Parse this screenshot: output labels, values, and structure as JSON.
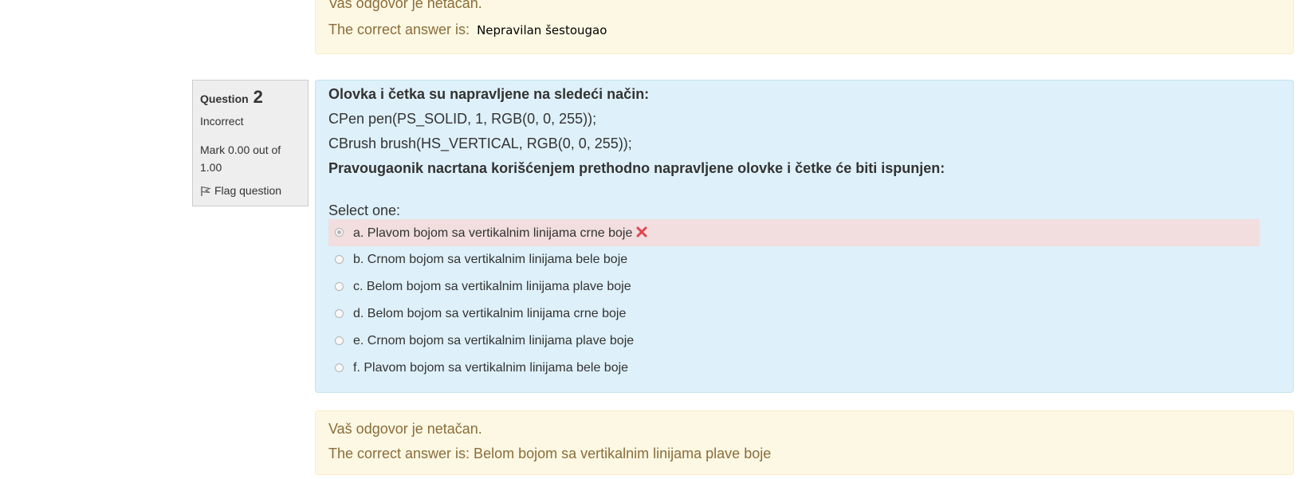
{
  "prev_feedback": {
    "message": "Vaš odgovor je netačan.",
    "correct_prefix": "The correct answer is:",
    "correct_answer": "Nepravilan šestougao"
  },
  "question_info": {
    "label": "Question",
    "number": "2",
    "state": "Incorrect",
    "grade": "Mark 0.00 out of 1.00",
    "flag_label": "Flag question"
  },
  "question": {
    "lines": [
      "Olovka i četka su napravljene na sledeći način:",
      "CPen pen(PS_SOLID, 1, RGB(0, 0, 255));",
      "CBrush brush(HS_VERTICAL, RGB(0, 0, 255));",
      "Pravougaonik nacrtana korišćenjem prethodno napravljene olovke i četke će biti ispunjen:"
    ],
    "prompt": "Select one:",
    "options": [
      {
        "letter": "a.",
        "text": "Plavom bojom sa vertikalnim linijama crne boje",
        "selected": true,
        "status": "incorrect"
      },
      {
        "letter": "b.",
        "text": "Crnom bojom sa vertikalnim linijama bele boje",
        "selected": false,
        "status": ""
      },
      {
        "letter": "c.",
        "text": "Belom bojom sa vertikalnim linijama plave boje",
        "selected": false,
        "status": ""
      },
      {
        "letter": "d.",
        "text": "Belom bojom sa vertikalnim linijama crne boje",
        "selected": false,
        "status": ""
      },
      {
        "letter": "e.",
        "text": "Crnom bojom sa vertikalnim linijama plave boje",
        "selected": false,
        "status": ""
      },
      {
        "letter": "f.",
        "text": "Plavom bojom sa vertikalnim linijama bele boje",
        "selected": false,
        "status": ""
      }
    ],
    "incorrect_icon": "red-x-icon"
  },
  "feedback": {
    "message": "Vaš odgovor je netačan.",
    "correct_answer_text": "The correct answer is: Belom bojom sa vertikalnim linijama plave boje"
  },
  "colors": {
    "content_bg": "#def0f9",
    "feedback_bg": "#fcf8e3",
    "feedback_text": "#8a6d3b",
    "incorrect_bg": "#f2dede",
    "info_bg": "#eeeeee",
    "x_mark": "#e0454f"
  }
}
